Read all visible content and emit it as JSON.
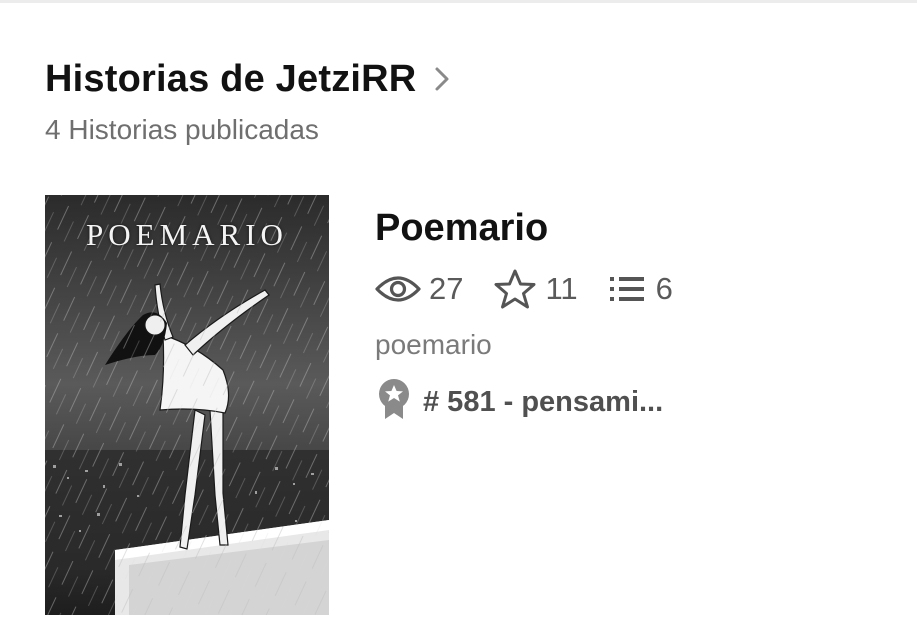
{
  "header": {
    "title": "Historias de JetziRR",
    "subtitle": "4 Historias publicadas",
    "chevron_icon": "chevron-right-icon"
  },
  "story": {
    "cover_title": "POEMARIO",
    "title": "Poemario",
    "stats": {
      "reads": "27",
      "votes": "11",
      "parts": "6",
      "reads_icon": "eye-icon",
      "votes_icon": "star-icon",
      "parts_icon": "list-icon"
    },
    "tag": "poemario",
    "rank": {
      "text": "# 581 - pensami...",
      "icon": "award-ribbon-icon"
    }
  },
  "colors": {
    "title": "#121212",
    "secondary": "#6f6f6f",
    "icon": "#555555",
    "divider": "#ececec"
  }
}
